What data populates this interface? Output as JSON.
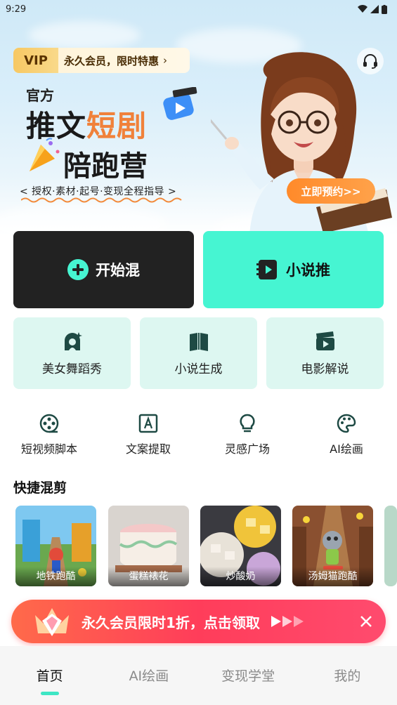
{
  "status_bar": {
    "time": "9:29"
  },
  "banner": {
    "vip_tag": "VIP",
    "vip_text": "永久会员，限时特惠",
    "official": "官方",
    "title_part1": "推文",
    "title_part2": "短剧",
    "title_line2": "陪跑营",
    "subtitle": "< 授权·素材·起号·变现全程指导 >",
    "reserve_button": "立即预约>>"
  },
  "actions": {
    "mix_label": "开始混",
    "novel_label": "小说推"
  },
  "feature_cards": [
    {
      "label": "美女舞蹈秀",
      "icon": "dancer-icon"
    },
    {
      "label": "小说生成",
      "icon": "book-icon"
    },
    {
      "label": "电影解说",
      "icon": "clapperboard-icon"
    }
  ],
  "tools": [
    {
      "label": "短视频脚本",
      "icon": "film-reel-icon"
    },
    {
      "label": "文案提取",
      "icon": "text-extract-icon"
    },
    {
      "label": "灵感广场",
      "icon": "lightbulb-icon"
    },
    {
      "label": "AI绘画",
      "icon": "palette-icon"
    }
  ],
  "quick_mix": {
    "title": "快捷混剪",
    "items": [
      {
        "label": "地铁跑酷"
      },
      {
        "label": "蛋糕裱花"
      },
      {
        "label": "炒酸奶"
      },
      {
        "label": "汤姆猫跑酷"
      }
    ]
  },
  "promo": {
    "text": "永久会员限时1折，点击领取"
  },
  "tabbar": {
    "tabs": [
      {
        "label": "首页",
        "active": true
      },
      {
        "label": "AI绘画",
        "active": false
      },
      {
        "label": "变现学堂",
        "active": false
      },
      {
        "label": "我的",
        "active": false
      }
    ]
  },
  "colors": {
    "accent": "#46f5d2",
    "dark_button": "#222222",
    "card_bg": "#ddf7f1",
    "promo": "#ff3d5a",
    "reserve": "#ff8a2a"
  }
}
